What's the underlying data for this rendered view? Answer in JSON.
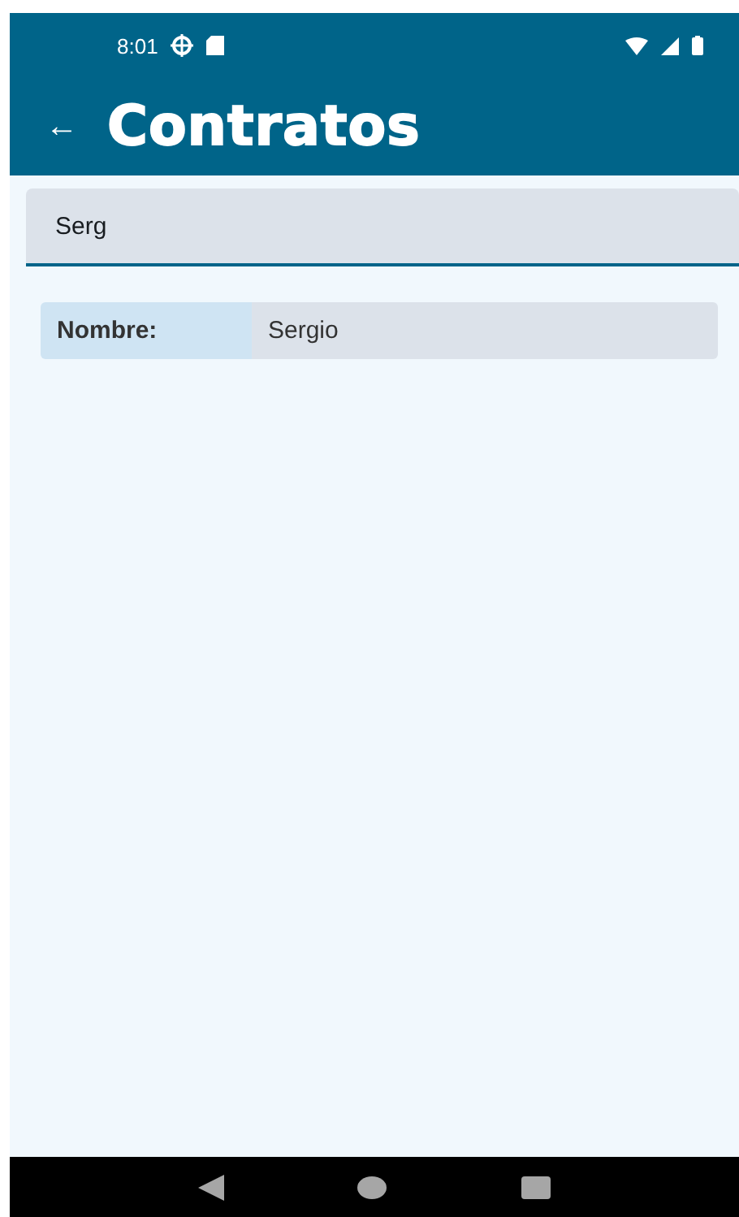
{
  "status_bar": {
    "time": "8:01"
  },
  "app_bar": {
    "back": "←",
    "title": "Contratos"
  },
  "search": {
    "value": "Serg"
  },
  "results": [
    {
      "label": "Nombre:",
      "value": "Sergio"
    }
  ]
}
